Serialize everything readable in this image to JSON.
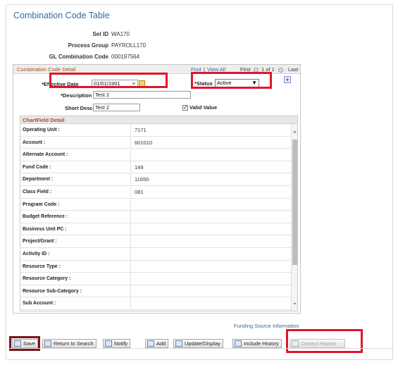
{
  "page": {
    "title": "Combination Code Table"
  },
  "header": {
    "setid_label": "Set ID",
    "setid_value": "WA170",
    "process_group_label": "Process Group",
    "process_group_value": "PAYROLL170",
    "gl_code_label": "GL Combination Code",
    "gl_code_value": "000197564"
  },
  "section": {
    "title": "Combination Code Detail",
    "find": "Find",
    "sep": "|",
    "view_all": "View All",
    "first": "First",
    "page_info": "1 of 1",
    "last": "Last"
  },
  "form": {
    "effective_date_label": "*Effective Date",
    "effective_date_value": "01/01/1901",
    "clear_glyph": "×",
    "status_label": "*Status",
    "status_value": "Active",
    "description_label": "*Description",
    "description_value": "Test 2",
    "short_desc_label": "Short Desc",
    "short_desc_value": "Test 2",
    "valid_value_label": "Valid Value",
    "valid_value_checked": true
  },
  "chartfield": {
    "title": "ChartField Detail",
    "rows": [
      {
        "label": "Operating Unit :",
        "value": "7171"
      },
      {
        "label": "Account :",
        "value": "601010"
      },
      {
        "label": "Alternate Account :",
        "value": ""
      },
      {
        "label": "Fund Code :",
        "value": "149"
      },
      {
        "label": "Department :",
        "value": "11650"
      },
      {
        "label": "Class Field :",
        "value": "081"
      },
      {
        "label": "Program Code :",
        "value": ""
      },
      {
        "label": "Budget Reference :",
        "value": ""
      },
      {
        "label": "Business Unit PC :",
        "value": ""
      },
      {
        "label": "Project/Grant :",
        "value": ""
      },
      {
        "label": "Activity ID :",
        "value": ""
      },
      {
        "label": "Resource Type :",
        "value": ""
      },
      {
        "label": "Resource Category :",
        "value": ""
      },
      {
        "label": "Resource Sub-Category :",
        "value": ""
      },
      {
        "label": "Sub Account :",
        "value": ""
      }
    ]
  },
  "funding_link": "Funding Source Information",
  "toolbar": {
    "save": "Save",
    "return": "Return to Search",
    "notify": "Notify",
    "add": "Add",
    "update": "Update/Display",
    "include": "Include History",
    "correct": "Correct History"
  },
  "colors": {
    "highlight": "#e0162b",
    "title": "#3d6a97",
    "section_title": "#a24f19"
  }
}
